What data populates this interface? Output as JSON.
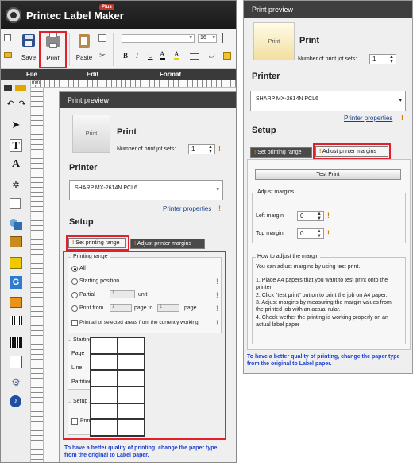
{
  "app": {
    "title": "Printec Label Maker",
    "badge": "Plus"
  },
  "ribbon": {
    "save_label": "Save",
    "print_label": "Print",
    "paste_label": "Paste",
    "font_size": "16",
    "group_file": "File",
    "group_edit": "Edit",
    "group_format": "Format",
    "format_buttons": [
      "B",
      "I",
      "U",
      "A",
      "A"
    ]
  },
  "ruler": {
    "unit": "mm"
  },
  "print_preview_left": {
    "header": "Print preview",
    "thumb_label": "Print",
    "print_title": "Print",
    "jot_label": "Number of print jot sets:",
    "jot_value": "1",
    "printer_title": "Printer",
    "printer_name": "SHARP MX-2614N PCL6",
    "printer_properties": "Printer properties",
    "setup_title": "Setup",
    "tabs": [
      "Set printing range",
      "Adjust printer margins"
    ],
    "printing_range_legend": "Printing range",
    "radio_all": "All",
    "radio_starting": "Starting position",
    "radio_partial": "Partial",
    "partial_value": "1",
    "partial_unit": "unit",
    "radio_print_from": "Print from",
    "from_value": "1",
    "page_to": "page to",
    "to_value": "1",
    "page_word": "page",
    "print_all_selected": "Print all of selected areas from the currently working",
    "starting_position_legend": "Starting position",
    "sp_page": "Page",
    "sp_line": "Line",
    "sp_partition": "Partition",
    "sp_page_val": "1",
    "sp_line_val": "1",
    "sp_partition_val": "1",
    "setup_legend": "Setup",
    "print_cutting_line": "Print cutting line",
    "note": "To have a better quality of printing, change the paper type from the original to Label paper."
  },
  "print_preview_right": {
    "header": "Print preview",
    "thumb_label": "Print",
    "print_title": "Print",
    "jot_label": "Number of print jot sets:",
    "jot_value": "1",
    "printer_title": "Printer",
    "printer_name": "SHARP MX-2614N PCL6",
    "printer_properties": "Printer properties",
    "setup_title": "Setup",
    "tabs": [
      "Set printing range",
      "Adjust printer margins"
    ],
    "test_print": "Test Print",
    "adjust_margins_legend": "Adjust margins",
    "left_margin": "Left margin",
    "left_margin_value": "0",
    "top_margin": "Top margin",
    "top_margin_value": "0",
    "how_to_legend": "How to adjust the margin",
    "how_to_lines": [
      "You can adjust margins by using test print.",
      "1. Place A4 papers that you want to test print onto the",
      "printer",
      "2. Click \"test print\" button to print the job on A4 paper.",
      "3. Adjust margins by measuring the margin values from",
      "the printed job with an actual rular.",
      "4. Check wether the printing is working properly on an",
      "actual label paper"
    ],
    "note": "To have a better quality of printing, change the paper type from the original to Label paper."
  },
  "colors": {
    "highlight": "#e0202a",
    "warning": "#e07b00",
    "note_blue": "#1c3fd1",
    "header_dark": "#3f3f3f"
  }
}
